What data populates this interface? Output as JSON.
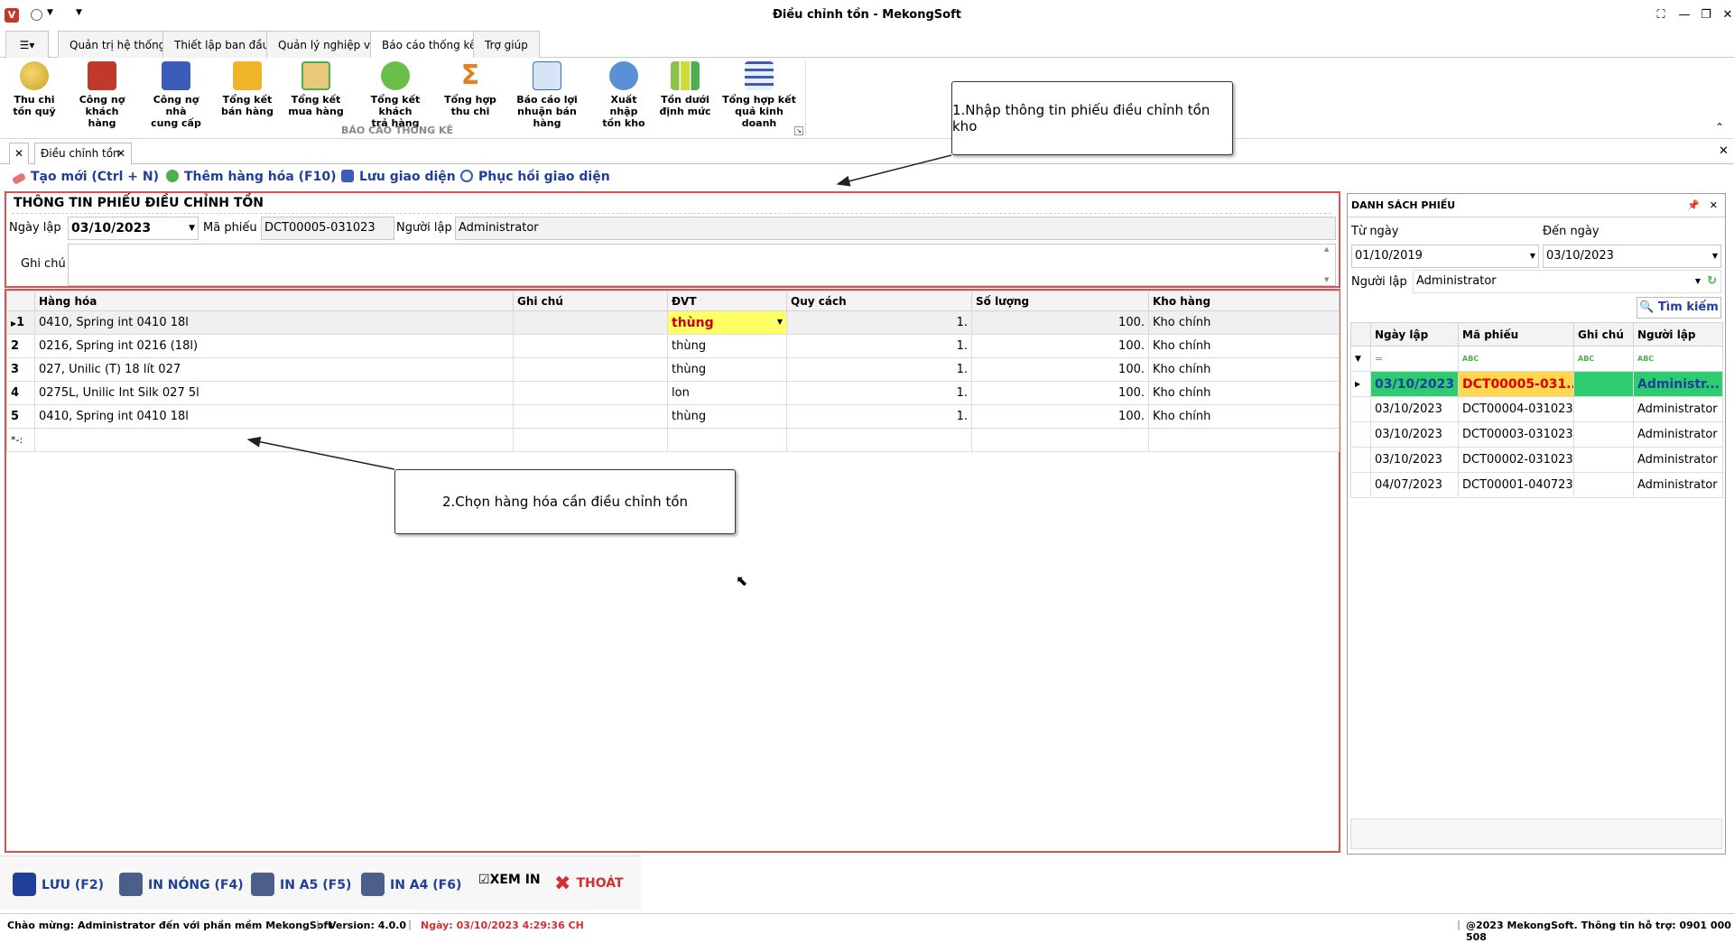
{
  "window": {
    "title": "Điều chỉnh tồn - MekongSoft"
  },
  "ribbon_tabs": [
    "Quản trị hệ thống",
    "Thiết lập ban đầu",
    "Quản lý nghiệp vụ",
    "Báo cáo thống kê",
    "Trợ giúp"
  ],
  "ribbon": {
    "group_label": "BÁO CÁO THỐNG KÊ",
    "buttons": [
      {
        "line1": "Thu chi",
        "line2": "tồn quỹ",
        "icon": "coins-icon"
      },
      {
        "line1": "Công nợ",
        "line2": "khách hàng",
        "icon": "customer-debt-icon"
      },
      {
        "line1": "Công nợ nhà",
        "line2": "cung cấp",
        "icon": "supplier-debt-icon"
      },
      {
        "line1": "Tổng kết",
        "line2": "bán hàng",
        "icon": "sales-summary-icon"
      },
      {
        "line1": "Tổng kết",
        "line2": "mua hàng",
        "icon": "purchase-summary-icon"
      },
      {
        "line1": "Tổng kết khách",
        "line2": "trả hàng",
        "icon": "return-summary-icon"
      },
      {
        "line1": "Tổng hợp",
        "line2": "thu chi",
        "icon": "sigma-icon"
      },
      {
        "line1": "Báo cáo lợi",
        "line2": "nhuận bán hàng",
        "icon": "profit-report-icon"
      },
      {
        "line1": "Xuất nhập",
        "line2": "tồn kho",
        "icon": "inventory-icon"
      },
      {
        "line1": "Tồn dưới",
        "line2": "định mức",
        "icon": "bar-chart-icon"
      },
      {
        "line1": "Tổng hợp kết",
        "line2": "quả kinh doanh",
        "icon": "business-result-icon"
      }
    ]
  },
  "doc_tab": "Điều chỉnh tồn",
  "toolbar": {
    "new": "Tạo mới (Ctrl + N)",
    "add_item": "Thêm hàng hóa (F10)",
    "save_layout": "Lưu giao diện",
    "restore_layout": "Phục hồi giao diện"
  },
  "form": {
    "section_title": "THÔNG TIN PHIẾU ĐIỀU CHỈNH TỒN",
    "date_label": "Ngày lập",
    "date_value": "03/10/2023",
    "code_label": "Mã phiếu",
    "code_value": "DCT00005-031023",
    "creator_label": "Người lập",
    "creator_value": "Administrator",
    "note_label": "Ghi chú",
    "note_value": ""
  },
  "grid": {
    "columns": [
      "Hàng hóa",
      "Ghi chú",
      "ĐVT",
      "Quy cách",
      "Số lượng",
      "Kho hàng"
    ],
    "rows": [
      {
        "no": "1",
        "item": "0410, Spring int 0410 18l",
        "note": "",
        "unit": "thùng",
        "spec": "1.",
        "qty": "100.",
        "store": "Kho chính"
      },
      {
        "no": "2",
        "item": "0216, Spring int 0216 (18l)",
        "note": "",
        "unit": "thùng",
        "spec": "1.",
        "qty": "100.",
        "store": "Kho chính"
      },
      {
        "no": "3",
        "item": "027, Unilic (T) 18 lít 027",
        "note": "",
        "unit": "thùng",
        "spec": "1.",
        "qty": "100.",
        "store": "Kho chính"
      },
      {
        "no": "4",
        "item": "0275L, Unilic Int Silk 027 5l",
        "note": "",
        "unit": "lon",
        "spec": "1.",
        "qty": "100.",
        "store": "Kho chính"
      },
      {
        "no": "5",
        "item": "0410, Spring int 0410 18l",
        "note": "",
        "unit": "thùng",
        "spec": "1.",
        "qty": "100.",
        "store": "Kho chính"
      }
    ],
    "new_row_marker": "*-:"
  },
  "right_panel": {
    "title": "DANH SÁCH PHIẾU",
    "from_label": "Từ ngày",
    "from_value": "01/10/2019",
    "to_label": "Đến ngày",
    "to_value": "03/10/2023",
    "creator_label": "Người lập",
    "creator_value": "Administrator",
    "search": "Tìm kiếm",
    "columns": [
      "Ngày lập",
      "Mã phiếu",
      "Ghi chú",
      "Người lập"
    ],
    "filter_eq": "=",
    "filter_abc": "ABC",
    "rows": [
      {
        "date": "03/10/2023",
        "code": "DCT00005-031...",
        "note": "",
        "creator": "Administr..."
      },
      {
        "date": "03/10/2023",
        "code": "DCT00004-031023",
        "note": "",
        "creator": "Administrator"
      },
      {
        "date": "03/10/2023",
        "code": "DCT00003-031023",
        "note": "",
        "creator": "Administrator"
      },
      {
        "date": "03/10/2023",
        "code": "DCT00002-031023",
        "note": "",
        "creator": "Administrator"
      },
      {
        "date": "04/07/2023",
        "code": "DCT00001-040723",
        "note": "",
        "creator": "Administrator"
      }
    ]
  },
  "annotations": {
    "callout1": "1.Nhập thông tin phiếu điều chỉnh tồn kho",
    "callout2": "2.Chọn hàng hóa cần điều chỉnh tồn"
  },
  "bottom": {
    "save": "LƯU (F2)",
    "print_hot": "IN NÓNG (F4)",
    "print_a5": "IN A5 (F5)",
    "print_a4": "IN A4 (F6)",
    "preview": "XEM IN",
    "exit": "THOÁT"
  },
  "status": {
    "welcome": "Chào mừng: Administrator đến với phần mềm MekongSoft",
    "version": "Version: 4.0.0",
    "date": "Ngày: 03/10/2023 4:29:36 CH",
    "copyright": "@2023 MekongSoft. Thông tin hỗ trợ: 0901 000 508"
  },
  "colors": {
    "accent_blue": "#1f3f9a",
    "highlight_red": "#d9534f",
    "selected_row_green": "#2ecc71",
    "selected_cell_yellow": "#ffff66"
  }
}
